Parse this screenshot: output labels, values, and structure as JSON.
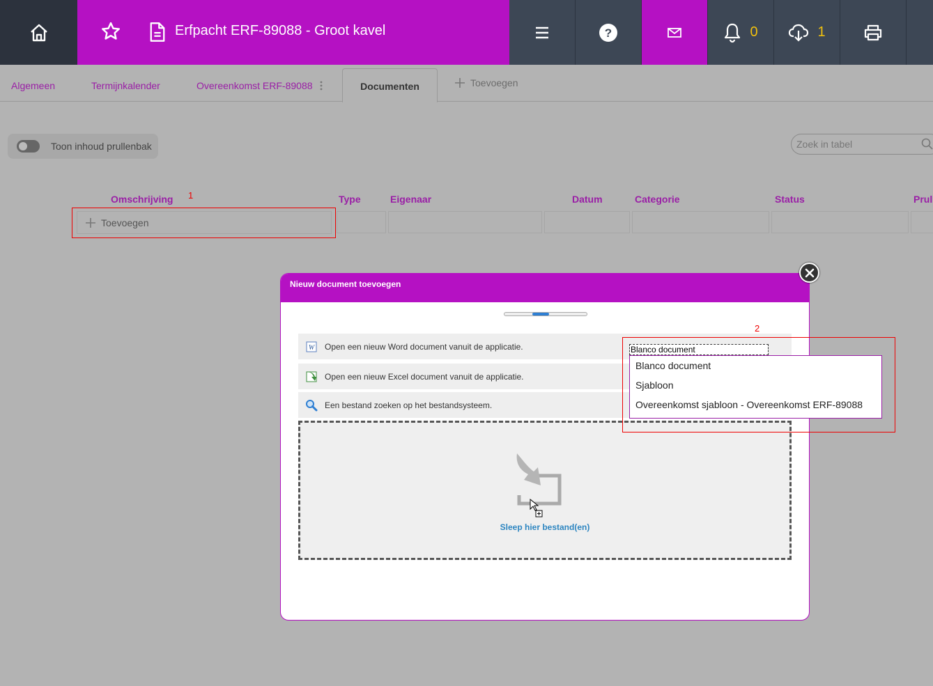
{
  "topbar": {
    "title": "Erfpacht ERF-89088 - Groot kavel",
    "notifications_count": "0",
    "downloads_count": "1",
    "icons": [
      "home-icon",
      "star-icon",
      "document-icon",
      "menu-icon",
      "help-icon",
      "mail-icon",
      "bell-icon",
      "download-icon",
      "print-icon"
    ],
    "colors": {
      "brand": "#b511c3",
      "dark": "#3d4755",
      "count": "#f2c10d"
    }
  },
  "tabs": {
    "items": [
      {
        "label": "Algemeen"
      },
      {
        "label": "Termijnkalender"
      },
      {
        "label": "Overeenkomst ERF-89088"
      }
    ],
    "active": "Documenten",
    "add": "Toevoegen"
  },
  "toolbar": {
    "toggle_label": "Toon inhoud prullenbak",
    "search_placeholder": "Zoek in tabel"
  },
  "table": {
    "headers": [
      "Omschrijving",
      "Type",
      "Eigenaar",
      "Datum",
      "Categorie",
      "Status",
      "Prul"
    ],
    "add_label": "Toevoegen"
  },
  "annotations": {
    "one": "1",
    "two": "2"
  },
  "modal": {
    "title": "Nieuw document toevoegen",
    "progress": 0.33,
    "options": [
      "Open een nieuw Word document vanuit de applicatie.",
      "Open een nieuw Excel document vanuit de applicatie.",
      "Een bestand zoeken op het bestandsysteem."
    ],
    "dropzone_text": "Sleep hier bestand(en)",
    "select_value": "Blanco document",
    "dropdown_options": [
      "Blanco document",
      "Sjabloon",
      "Overeenkomst sjabloon - Overeenkomst ERF-89088"
    ]
  }
}
